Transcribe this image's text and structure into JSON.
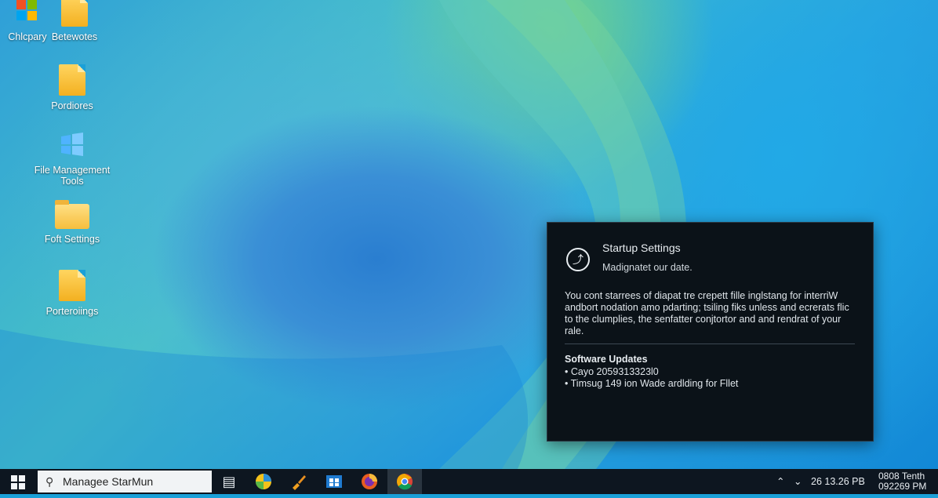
{
  "desktop": {
    "icons": [
      {
        "label": "Chlcpary",
        "icon": "windows-logo-icon"
      },
      {
        "label": "Betewotes",
        "icon": "file-icon"
      },
      {
        "label": "Pordiores",
        "icon": "file-icon"
      },
      {
        "label": "File Management\nTools",
        "icon": "windows-flag-icon"
      },
      {
        "label": "Foft Settings",
        "icon": "folder-icon"
      },
      {
        "label": "Porteroiings",
        "icon": "file-icon"
      }
    ]
  },
  "popup": {
    "icon": "wrench-icon",
    "title": "Startup Settings",
    "subtitle": "Madignatet our date.",
    "body": "You cont starrees of diapat tre crepett fille inglstang for interriW andbort nodation amo pdarting; tsiling fiks unless and ecrerats flic to the clumplies, the senfatter conjtortor and and rendrat of your rale.",
    "section_title": "Software Updates",
    "items": [
      "Cayo 2059313323l0",
      "Timsug 149 ion Wade ardlding for Fllet"
    ]
  },
  "taskbar": {
    "search_placeholder": "Managee StarMun",
    "apps": [
      "task-view-icon",
      "media-player-icon",
      "paint-brush-icon",
      "store-icon",
      "firefox-icon",
      "chrome-icon"
    ],
    "tray_time_label": "26 13.26 PB",
    "clock": {
      "line1": "0808 Tenth",
      "line2": "092269 PM"
    }
  },
  "colors": {
    "taskbar": "#0d1620",
    "panel": "#0b1218",
    "accent": "#1aa0d8"
  }
}
